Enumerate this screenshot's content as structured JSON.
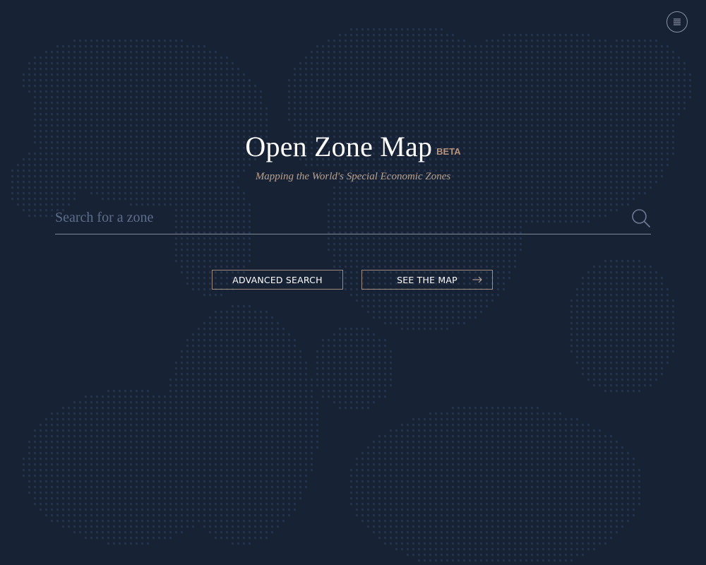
{
  "header": {
    "title": "Open Zone Map",
    "badge": "BETA",
    "subtitle": "Mapping the World's Special Economic Zones"
  },
  "search": {
    "placeholder": "Search for a zone",
    "value": ""
  },
  "actions": {
    "advanced_search_label": "ADVANCED SEARCH",
    "see_map_label": "SEE THE MAP"
  },
  "icons": {
    "menu": "menu-icon",
    "search": "search-icon",
    "arrow": "arrow-right-icon",
    "background": "world-map-dots"
  },
  "colors": {
    "background": "#172235",
    "title": "#ffffff",
    "accent": "#b9927a",
    "button_border": "#a08a7e",
    "placeholder": "#5e6d8a",
    "dots": "#243249"
  }
}
